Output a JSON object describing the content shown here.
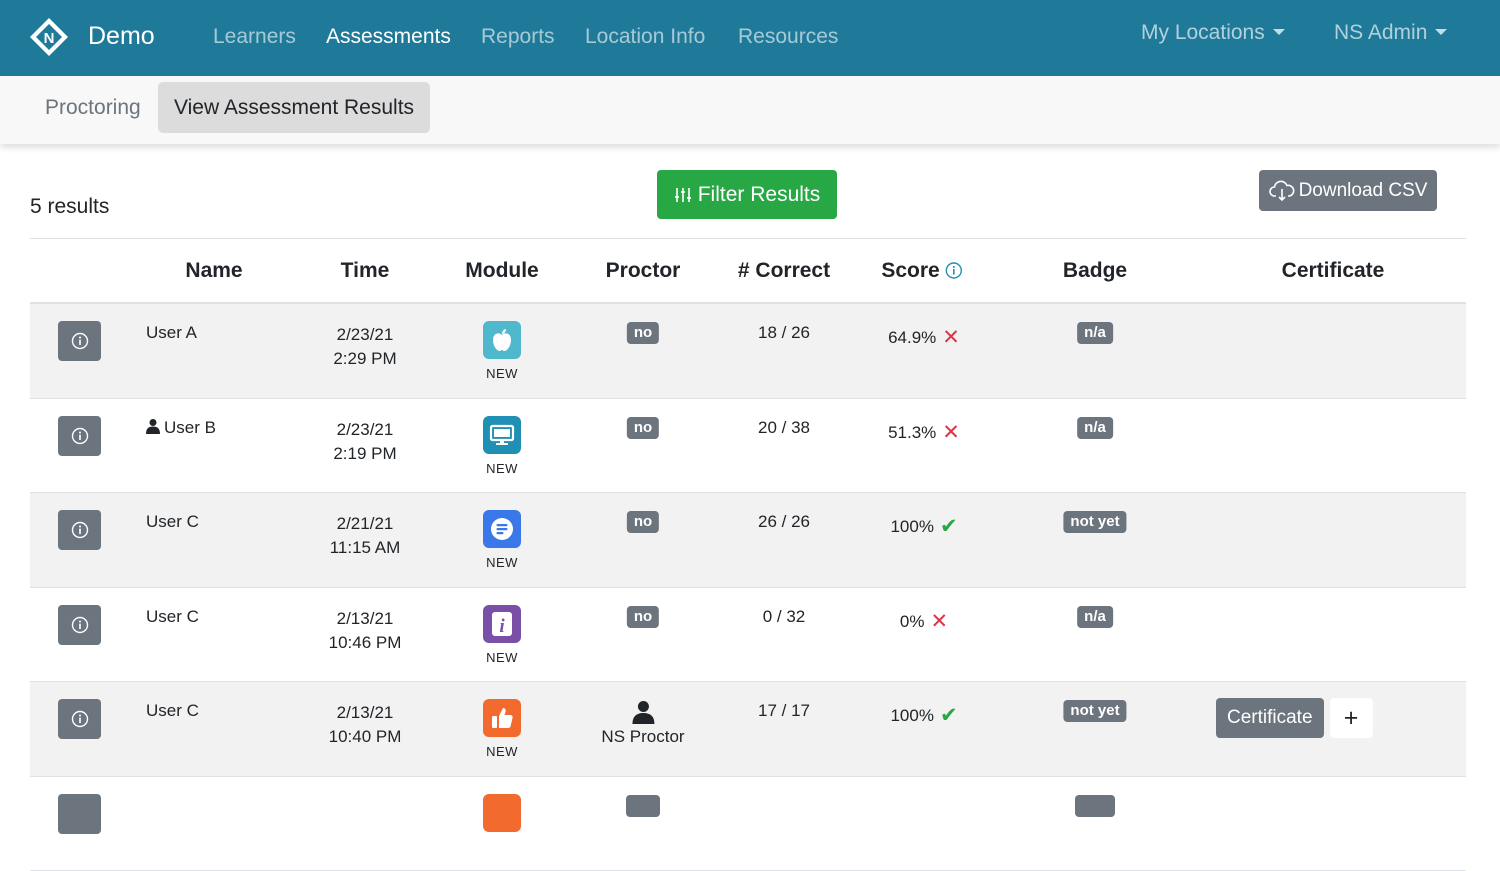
{
  "app": {
    "brand": "Demo"
  },
  "nav": {
    "links": [
      "Learners",
      "Assessments",
      "Reports",
      "Location Info",
      "Resources"
    ],
    "active": "Assessments",
    "my_locations": "My Locations",
    "user_menu": "NS Admin"
  },
  "subnav": {
    "proctoring": "Proctoring",
    "view_results": "View Assessment Results"
  },
  "toolbar": {
    "results_count": "5 results",
    "filter_label": "Filter Results",
    "download_label": "Download CSV"
  },
  "table": {
    "headers": {
      "name": "Name",
      "time": "Time",
      "module": "Module",
      "proctor": "Proctor",
      "correct": "# Correct",
      "score": "Score",
      "badge": "Badge",
      "certificate": "Certificate"
    },
    "rows": [
      {
        "name": "User A",
        "date": "2/23/21",
        "time": "2:29 PM",
        "module_icon": "apple-icon",
        "module_color": "#4fb8cc",
        "module_tag": "NEW",
        "proctor": "no",
        "correct": "18 / 26",
        "score": "64.9%",
        "badge": "n/a"
      },
      {
        "name": "User B",
        "date": "2/23/21",
        "time": "2:19 PM",
        "module_icon": "monitor-icon",
        "module_color": "#1f8fb3",
        "module_tag": "NEW",
        "proctor": "no",
        "correct": "20 / 38",
        "score": "51.3%",
        "badge": "n/a"
      },
      {
        "name": "User C",
        "date": "2/21/21",
        "time": "11:15 AM",
        "module_icon": "document-icon",
        "module_color": "#3a77e8",
        "module_tag": "NEW",
        "proctor": "no",
        "correct": "26 / 26",
        "score": "100%",
        "badge": "not yet"
      },
      {
        "name": "User C",
        "date": "2/13/21",
        "time": "10:46 PM",
        "module_icon": "info-letter-icon",
        "module_color": "#7a4fa8",
        "module_tag": "NEW",
        "proctor": "no",
        "correct": "0 / 32",
        "score": "0%",
        "badge": "n/a"
      },
      {
        "name": "User C",
        "date": "2/13/21",
        "time": "10:40 PM",
        "module_icon": "thumbs-up-icon",
        "module_color": "#f26a2e",
        "module_tag": "NEW",
        "proctor": "NS Proctor",
        "correct": "17 / 17",
        "score": "100%",
        "badge": "not yet",
        "certificate": "Certificate",
        "certificate_add": "+"
      }
    ]
  },
  "colors": {
    "navbar": "#1f7a99",
    "success": "#28a745",
    "secondary": "#6c757d",
    "danger": "#dc3545"
  }
}
